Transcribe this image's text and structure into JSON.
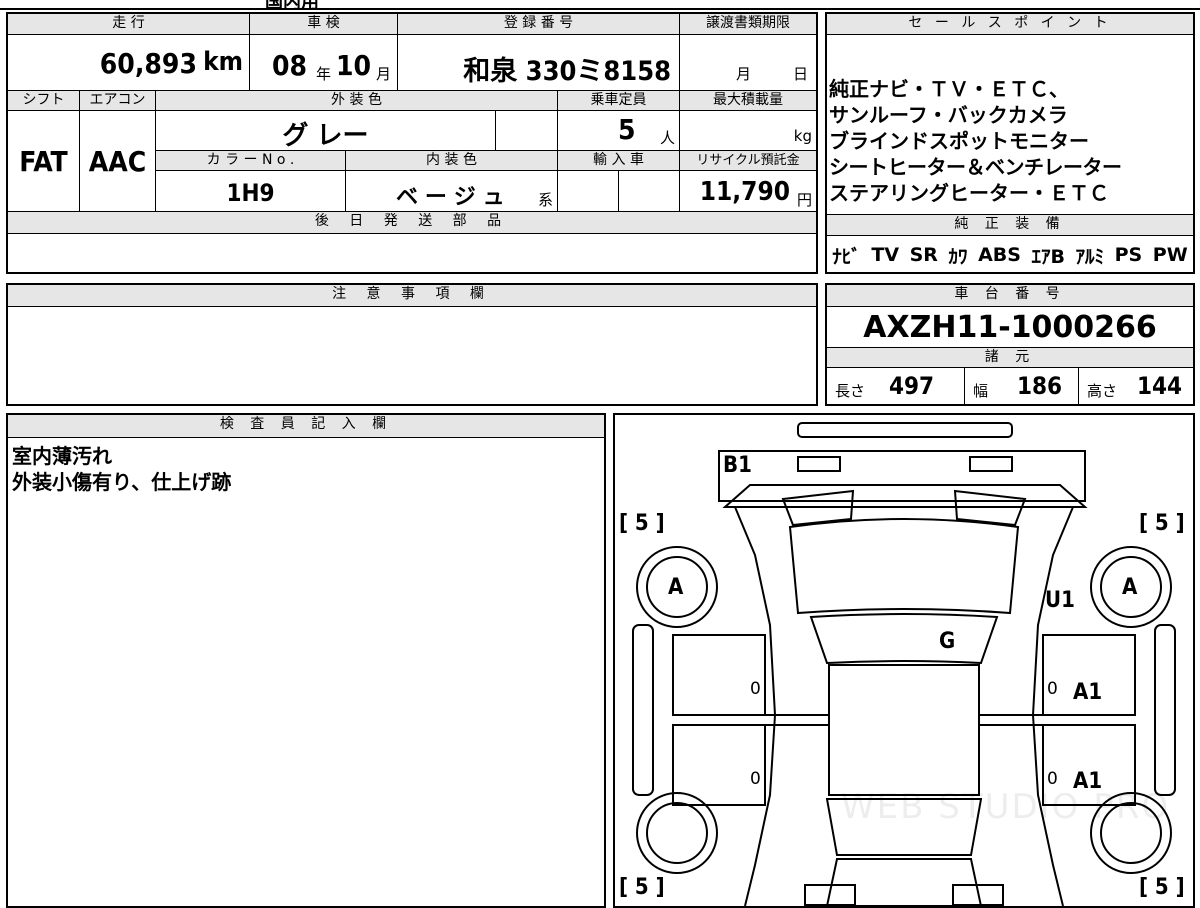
{
  "header": {
    "mileage_label": "走 行",
    "mileage_value": "60,893",
    "mileage_unit": "km",
    "inspection_label": "車 検",
    "inspection_year": "08",
    "inspection_year_unit": "年",
    "inspection_month": "10",
    "inspection_month_unit": "月",
    "registration_label": "登 録 番 号",
    "registration_value": "和泉 330ミ8158",
    "transfer_deadline_label": "譲渡書類期限",
    "transfer_month_unit": "月",
    "transfer_day_unit": "日",
    "top_partial_text": "国内用"
  },
  "row2": {
    "shift_label": "シフト",
    "shift_value": "FAT",
    "aircon_label": "エアコン",
    "aircon_value": "AAC",
    "exterior_color_label": "外 装 色",
    "exterior_color_value": "グ レー",
    "capacity_label": "乗車定員",
    "capacity_value": "5",
    "capacity_unit": "人",
    "max_load_label": "最大積載量",
    "max_load_unit": "kg",
    "color_no_label": "カ ラ ー N o .",
    "color_no_value": "1H9",
    "interior_color_label": "内 装 色",
    "interior_color_value": "ベ ー ジ ュ",
    "interior_color_suffix": "系",
    "import_label": "輸 入 車",
    "recycle_label": "リサイクル預託金",
    "recycle_value": "11,790",
    "recycle_unit": "円"
  },
  "later_parts": {
    "label": "後 日 発 送 部 品"
  },
  "sales_points": {
    "label": "セ ー ル ス ポ イ ン ト",
    "lines": [
      "純正ナビ・ＴＶ・ＥＴＣ、",
      "サンルーフ・バックカメラ",
      "ブラインドスポットモニター",
      "シートヒーター＆ベンチレーター",
      "ステアリングヒーター・ＥＴＣ"
    ]
  },
  "equipment": {
    "label": "純 正 装 備",
    "items": [
      "ﾅﾋﾞ",
      "TV",
      "SR",
      "ｶﾜ",
      "ABS",
      "ｴｱB",
      "ｱﾙﾐ",
      "PS",
      "PW"
    ]
  },
  "notes": {
    "label": "注 意 事 項 欄"
  },
  "chassis": {
    "label": "車 台 番 号",
    "value": "AXZH11-1000266",
    "spec_label": "諸 元",
    "length_label": "長さ",
    "length_value": "497",
    "width_label": "幅",
    "width_value": "186",
    "height_label": "高さ",
    "height_value": "144"
  },
  "inspector": {
    "label": "検 査 員 記 入 欄",
    "lines": [
      "室内薄汚れ",
      "外装小傷有り、仕上げ跡"
    ]
  },
  "diagram": {
    "marks": {
      "b1": "B1",
      "a_left": "A",
      "a_right": "A",
      "u1": "U1",
      "g": "G",
      "a1_front": "A1",
      "a1_rear": "A1"
    },
    "tire_tread": {
      "front_left": "[ 5 ]",
      "front_right": "[ 5 ]",
      "rear_left": "[ 5 ]",
      "rear_right": "[ 5 ]"
    },
    "zeros": [
      "0",
      "0",
      "0",
      "0"
    ],
    "watermark": "WEB STUDIO PRO"
  }
}
